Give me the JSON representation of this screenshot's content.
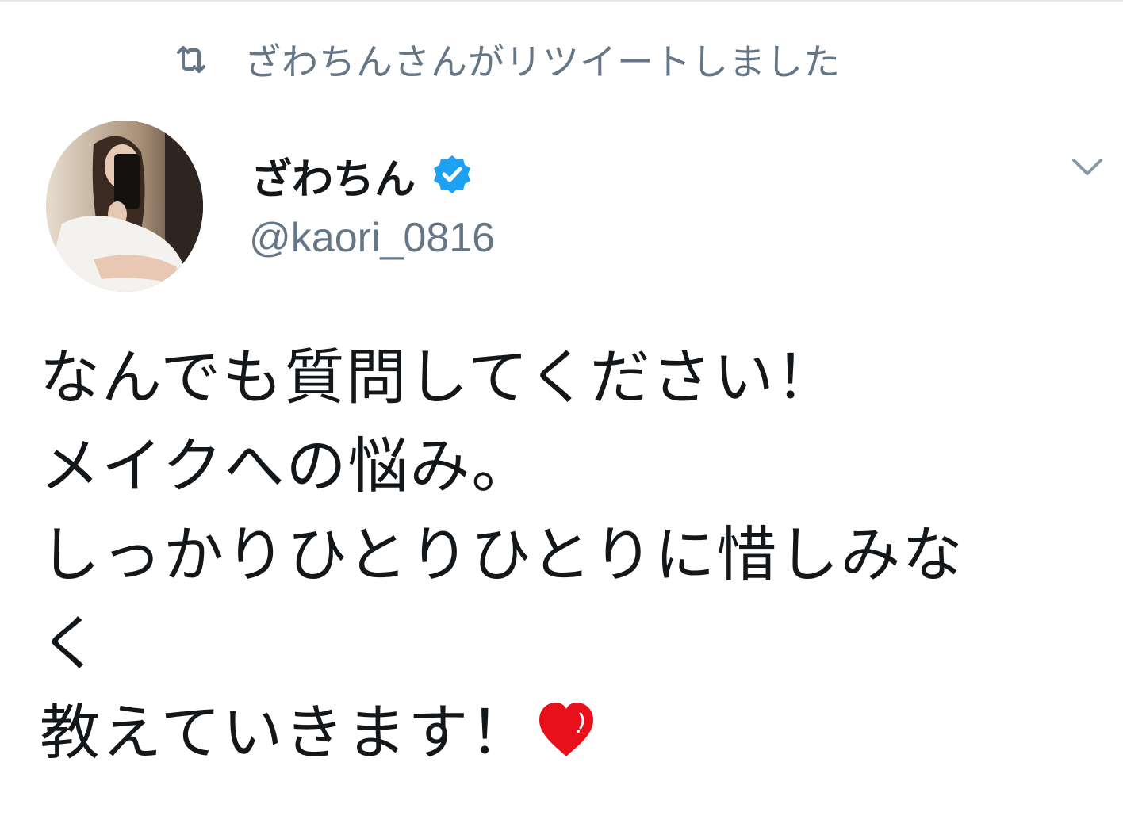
{
  "retweet": {
    "icon": "retweet-icon",
    "text": "ざわちんさんがリツイートしました"
  },
  "author": {
    "display_name": "ざわちん",
    "verified": true,
    "handle": "@kaori_0816"
  },
  "tweet": {
    "lines": [
      "なんでも質問してください！",
      "メイクへの悩み。",
      "しっかりひとりひとりに惜しみな",
      "く",
      "教えていきます！"
    ],
    "emoji": "heart-icon"
  },
  "colors": {
    "muted": "#657786",
    "text": "#14171a",
    "verified": "#1da1f2",
    "heart": "#e8101a"
  }
}
